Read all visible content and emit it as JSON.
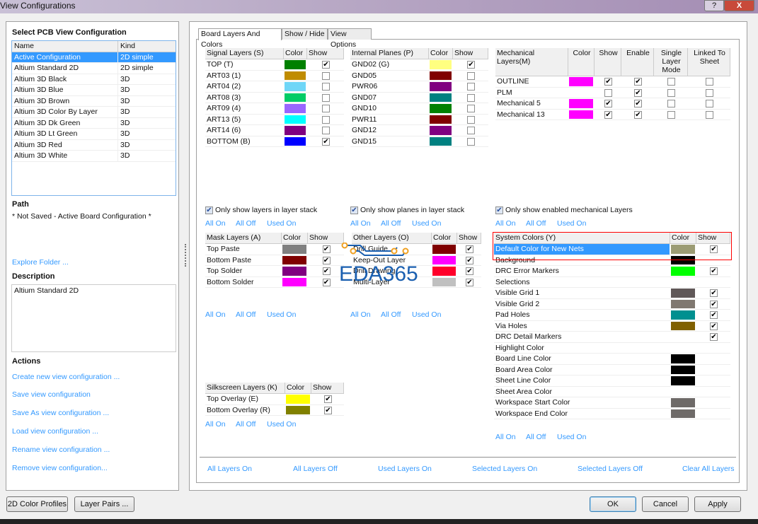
{
  "window": {
    "title": "View Configurations",
    "help": "?",
    "close": "X"
  },
  "left": {
    "heading": "Select PCB View Configuration",
    "columns": [
      "Name",
      "Kind"
    ],
    "configs": [
      {
        "name": "Active Configuration",
        "kind": "2D simple",
        "selected": true
      },
      {
        "name": "Altium Standard 2D",
        "kind": "2D simple"
      },
      {
        "name": "Altium 3D Black",
        "kind": "3D"
      },
      {
        "name": "Altium 3D Blue",
        "kind": "3D"
      },
      {
        "name": "Altium 3D Brown",
        "kind": "3D"
      },
      {
        "name": "Altium 3D Color By Layer",
        "kind": "3D"
      },
      {
        "name": "Altium 3D Dk Green",
        "kind": "3D"
      },
      {
        "name": "Altium 3D Lt Green",
        "kind": "3D"
      },
      {
        "name": "Altium 3D Red",
        "kind": "3D"
      },
      {
        "name": "Altium 3D White",
        "kind": "3D"
      }
    ],
    "path_label": "Path",
    "path_value": "* Not Saved - Active Board Configuration *",
    "explore": "Explore Folder ...",
    "description_label": "Description",
    "description_value": "Altium Standard 2D",
    "actions_label": "Actions",
    "actions": [
      "Create new view configuration ...",
      "Save view configuration",
      "Save As view configuration ...",
      "Load view configuration ...",
      "Rename view configuration ...",
      "Remove view configuration..."
    ]
  },
  "tabs": [
    "Board Layers And Colors",
    "Show / Hide",
    "View Options"
  ],
  "tables": {
    "signal": {
      "headers": [
        "Signal Layers (S)",
        "Color",
        "Show"
      ],
      "rows": [
        {
          "name": "TOP (T)",
          "color": "#008000",
          "show": true
        },
        {
          "name": "ART03 (1)",
          "color": "#c08c00",
          "show": false
        },
        {
          "name": "ART04 (2)",
          "color": "#6fd6f7",
          "show": false
        },
        {
          "name": "ART08 (3)",
          "color": "#00cc66",
          "show": false
        },
        {
          "name": "ART09 (4)",
          "color": "#9966ff",
          "show": false
        },
        {
          "name": "ART13 (5)",
          "color": "#00ffff",
          "show": false
        },
        {
          "name": "ART14 (6)",
          "color": "#800080",
          "show": false
        },
        {
          "name": "BOTTOM (B)",
          "color": "#0000ff",
          "show": true
        }
      ]
    },
    "planes": {
      "headers": [
        "Internal Planes (P)",
        "Color",
        "Show"
      ],
      "rows": [
        {
          "name": "GND02 (G)",
          "color": "#ffff80",
          "show": true
        },
        {
          "name": "GND05",
          "color": "#800000",
          "show": false
        },
        {
          "name": "PWR06",
          "color": "#800080",
          "show": false
        },
        {
          "name": "GND07",
          "color": "#008080",
          "show": false
        },
        {
          "name": "GND10",
          "color": "#008000",
          "show": false
        },
        {
          "name": "PWR11",
          "color": "#800000",
          "show": false
        },
        {
          "name": "GND12",
          "color": "#800080",
          "show": false
        },
        {
          "name": "GND15",
          "color": "#008080",
          "show": false
        }
      ]
    },
    "mechanical": {
      "headers": [
        "Mechanical Layers(M)",
        "Color",
        "Show",
        "Enable",
        "Single Layer Mode",
        "Linked To Sheet"
      ],
      "rows": [
        {
          "name": "OUTLINE",
          "color": "#ff00ff",
          "show": true,
          "enable": true,
          "single": false,
          "linked": false
        },
        {
          "name": "PLM",
          "color": null,
          "show": false,
          "enable": true,
          "single": false,
          "linked": false
        },
        {
          "name": "Mechanical 5",
          "color": "#ff00ff",
          "show": true,
          "enable": true,
          "single": false,
          "linked": false
        },
        {
          "name": "Mechanical 13",
          "color": "#ff00ff",
          "show": true,
          "enable": true,
          "single": false,
          "linked": false
        }
      ]
    },
    "mask": {
      "headers": [
        "Mask Layers (A)",
        "Color",
        "Show"
      ],
      "rows": [
        {
          "name": "Top Paste",
          "color": "#808080",
          "show": true
        },
        {
          "name": "Bottom Paste",
          "color": "#800000",
          "show": true
        },
        {
          "name": "Top Solder",
          "color": "#800080",
          "show": true
        },
        {
          "name": "Bottom Solder",
          "color": "#ff00ff",
          "show": true
        }
      ]
    },
    "other": {
      "headers": [
        "Other Layers (O)",
        "Color",
        "Show"
      ],
      "rows": [
        {
          "name": "Drill Guide",
          "color": "#800000",
          "show": true
        },
        {
          "name": "Keep-Out Layer",
          "color": "#ff00ff",
          "show": true
        },
        {
          "name": "Drill Drawing",
          "color": "#ff002a",
          "show": true
        },
        {
          "name": "Multi-Layer",
          "color": "#c0c0c0",
          "show": true
        }
      ]
    },
    "system": {
      "headers": [
        "System Colors (Y)",
        "Color",
        "Show"
      ],
      "rows": [
        {
          "name": "Default Color for New Nets",
          "color": "#9c9c74",
          "show": true,
          "selected": true
        },
        {
          "name": "Background",
          "color": "#000000",
          "show": null
        },
        {
          "name": "DRC Error Markers",
          "color": "#00ff00",
          "show": true
        },
        {
          "name": "Selections",
          "color": null,
          "show": null
        },
        {
          "name": "Visible Grid 1",
          "color": "#605858",
          "show": true
        },
        {
          "name": "Visible Grid 2",
          "color": "#807870",
          "show": true
        },
        {
          "name": "Pad Holes",
          "color": "#009090",
          "show": true
        },
        {
          "name": "Via Holes",
          "color": "#806000",
          "show": true
        },
        {
          "name": "DRC Detail Markers",
          "color": null,
          "show": true
        },
        {
          "name": "Highlight Color",
          "color": null,
          "show": null
        },
        {
          "name": "Board Line Color",
          "color": "#000000",
          "show": null
        },
        {
          "name": "Board Area Color",
          "color": "#000000",
          "show": null
        },
        {
          "name": "Sheet Line Color",
          "color": "#000000",
          "show": null
        },
        {
          "name": "Sheet Area Color",
          "color": null,
          "show": null
        },
        {
          "name": "Workspace Start Color",
          "color": "#6e6a68",
          "show": null
        },
        {
          "name": "Workspace End Color",
          "color": "#6e6a68",
          "show": null
        }
      ]
    },
    "silk": {
      "headers": [
        "Silkscreen Layers (K)",
        "Color",
        "Show"
      ],
      "rows": [
        {
          "name": "Top Overlay (E)",
          "color": "#ffff00",
          "show": true
        },
        {
          "name": "Bottom Overlay (R)",
          "color": "#808000",
          "show": true
        }
      ]
    }
  },
  "filters": {
    "layers": "Only show layers in layer stack",
    "planes": "Only show planes in layer stack",
    "mech": "Only show enabled mechanical Layers"
  },
  "quick": {
    "on": "All On",
    "off": "All Off",
    "used": "Used On"
  },
  "bottom_links": [
    "All Layers On",
    "All Layers Off",
    "Used Layers On",
    "Selected Layers On",
    "Selected Layers Off",
    "Clear All Layers"
  ],
  "buttons": {
    "profiles": "2D Color Profiles",
    "pairs": "Layer Pairs ...",
    "ok": "OK",
    "cancel": "Cancel",
    "apply": "Apply"
  },
  "watermark": "EDA365",
  "colors": {
    "link": "#3399ff",
    "selection": "#3399ff",
    "highlight_box": "#ff0000"
  }
}
